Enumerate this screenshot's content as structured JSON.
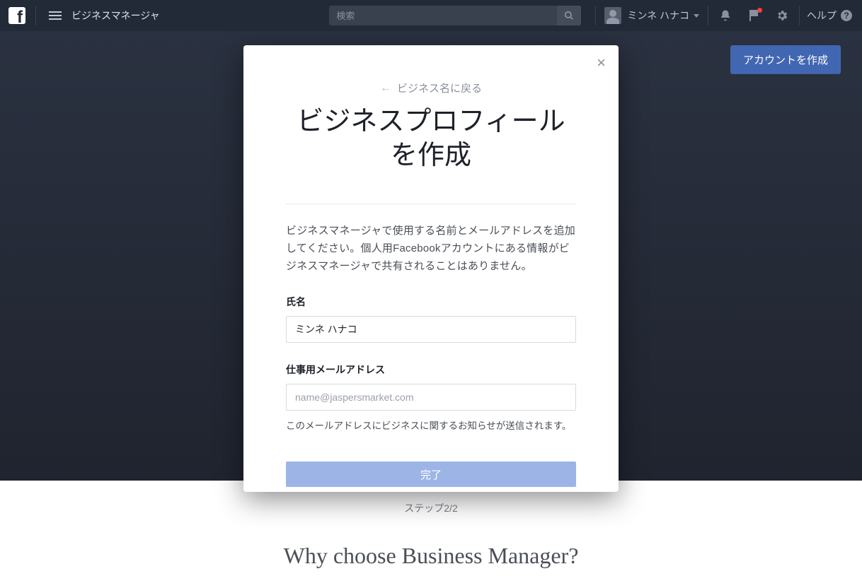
{
  "topbar": {
    "app_title": "ビジネスマネージャ",
    "search_placeholder": "検索",
    "username": "ミンネ ハナコ",
    "help_label": "ヘルプ"
  },
  "hero": {
    "cta_label": "アカウントを作成"
  },
  "why_section": {
    "heading": "Why choose Business Manager?"
  },
  "modal": {
    "back_label": "ビジネス名に戻る",
    "title": "ビジネスプロフィールを作成",
    "description": "ビジネスマネージャで使用する名前とメールアドレスを追加してください。個人用Facebookアカウントにある情報がビジネスマネージャで共有されることはありません。",
    "name_label": "氏名",
    "name_value": "ミンネ ハナコ",
    "email_label": "仕事用メールアドレス",
    "email_placeholder": "name@jaspersmarket.com",
    "email_helper": "このメールアドレスにビジネスに関するお知らせが送信されます。",
    "submit_label": "完了",
    "step_label": "ステップ2/2"
  }
}
